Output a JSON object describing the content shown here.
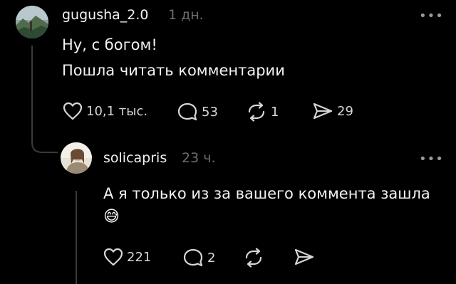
{
  "comments": [
    {
      "username": "gugusha_2.0",
      "time": "1 дн.",
      "text_lines": [
        "Ну, с богом!",
        "Пошла читать комментарии"
      ],
      "actions": {
        "likes": "10,1 тыс.",
        "comments": "53",
        "reposts": "1",
        "shares": "29"
      },
      "more_label": "•••"
    },
    {
      "username": "solicapris",
      "time": "23 ч.",
      "text_lines": [
        "А я только из за вашего коммента зашла"
      ],
      "emoji": "😅",
      "actions": {
        "likes": "221",
        "comments": "2"
      },
      "more_label": "•••"
    }
  ],
  "icons": {
    "avatar1": "landscape-avatar",
    "avatar2": "person-avatar",
    "like": "heart-icon",
    "comment": "comment-bubble-icon",
    "repost": "repost-icon",
    "share": "send-icon",
    "more": "more-dots-icon"
  },
  "colors": {
    "background": "#000000",
    "text": "#f3f3f3",
    "muted": "#6d6d6d",
    "icon": "#d6d6d6",
    "thread_line": "#3a3a3a"
  }
}
